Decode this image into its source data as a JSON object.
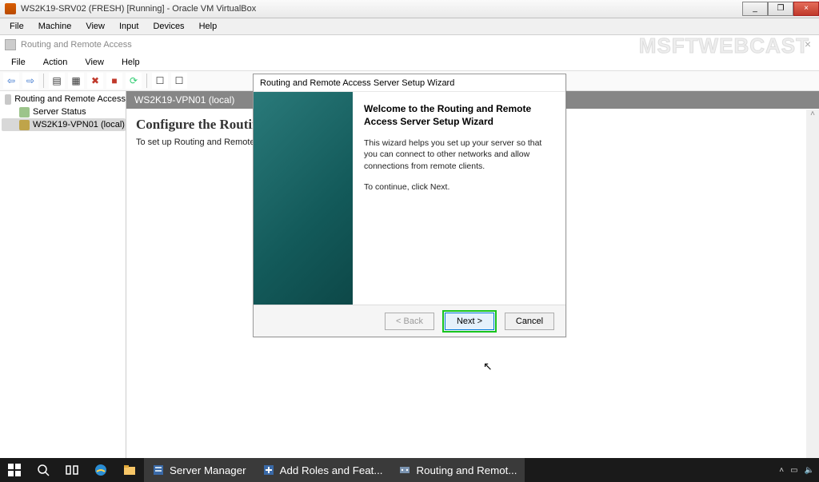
{
  "vbox": {
    "title": "WS2K19-SRV02 (FRESH) [Running] - Oracle VM VirtualBox",
    "menu": {
      "file": "File",
      "machine": "Machine",
      "view": "View",
      "input": "Input",
      "devices": "Devices",
      "help": "Help"
    },
    "min": "_",
    "max": "❐",
    "close": "×"
  },
  "mmc": {
    "app_title": "Routing and Remote Access",
    "menu": {
      "file": "File",
      "action": "Action",
      "view": "View",
      "help": "Help"
    },
    "tree": {
      "root": "Routing and Remote Access",
      "status": "Server Status",
      "server": "WS2K19-VPN01 (local)"
    },
    "content_header": "WS2K19-VPN01 (local)",
    "page_heading": "Configure the Routing and Remote Access Server",
    "page_desc": "To set up Routing and Remote A"
  },
  "watermark": "MSFTWEBCAST",
  "wizard": {
    "title": "Routing and Remote Access Server Setup Wizard",
    "heading": "Welcome to the Routing and Remote Access Server Setup Wizard",
    "para1": "This wizard helps you set up your server so that you can connect to other networks and allow connections from remote clients.",
    "para2": "To continue, click Next.",
    "back": "< Back",
    "next": "Next >",
    "cancel": "Cancel"
  },
  "taskbar": {
    "server_manager": "Server Manager",
    "add_roles": "Add Roles and Feat...",
    "rras": "Routing and Remot..."
  }
}
